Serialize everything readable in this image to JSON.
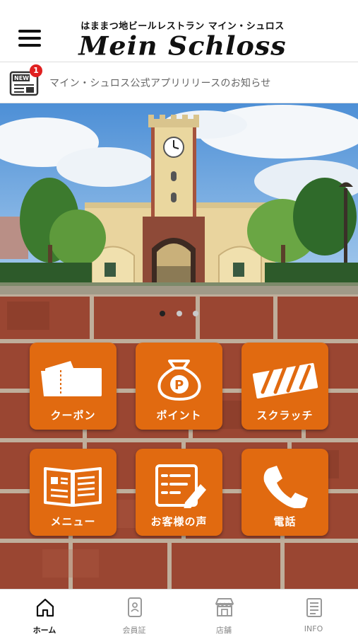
{
  "header": {
    "subtitle": "はままつ地ビールレストラン マイン・シュロス",
    "logo_text": "Mein Schloss"
  },
  "news": {
    "badge_label": "NEW",
    "badge_count": "1",
    "text": "マイン・シュロス公式アプリリリースのお知らせ"
  },
  "carousel": {
    "page_count": 3,
    "active_index": 0
  },
  "menu_tiles": [
    {
      "label": "クーポン",
      "icon": "ticket-icon"
    },
    {
      "label": "ポイント",
      "icon": "point-bag-icon"
    },
    {
      "label": "スクラッチ",
      "icon": "scratch-icon"
    },
    {
      "label": "メニュー",
      "icon": "menu-book-icon"
    },
    {
      "label": "お客様の声",
      "icon": "feedback-icon"
    },
    {
      "label": "電話",
      "icon": "phone-icon"
    }
  ],
  "tabbar": {
    "items": [
      {
        "label": "ホーム",
        "icon": "home-icon",
        "active": true
      },
      {
        "label": "会員証",
        "icon": "member-card-icon",
        "active": false
      },
      {
        "label": "店舗",
        "icon": "store-icon",
        "active": false
      },
      {
        "label": "INFO",
        "icon": "info-list-icon",
        "active": false
      }
    ]
  },
  "colors": {
    "tile_orange": "#e16a10",
    "brick": "#9c4a34",
    "badge_red": "#e02020"
  }
}
